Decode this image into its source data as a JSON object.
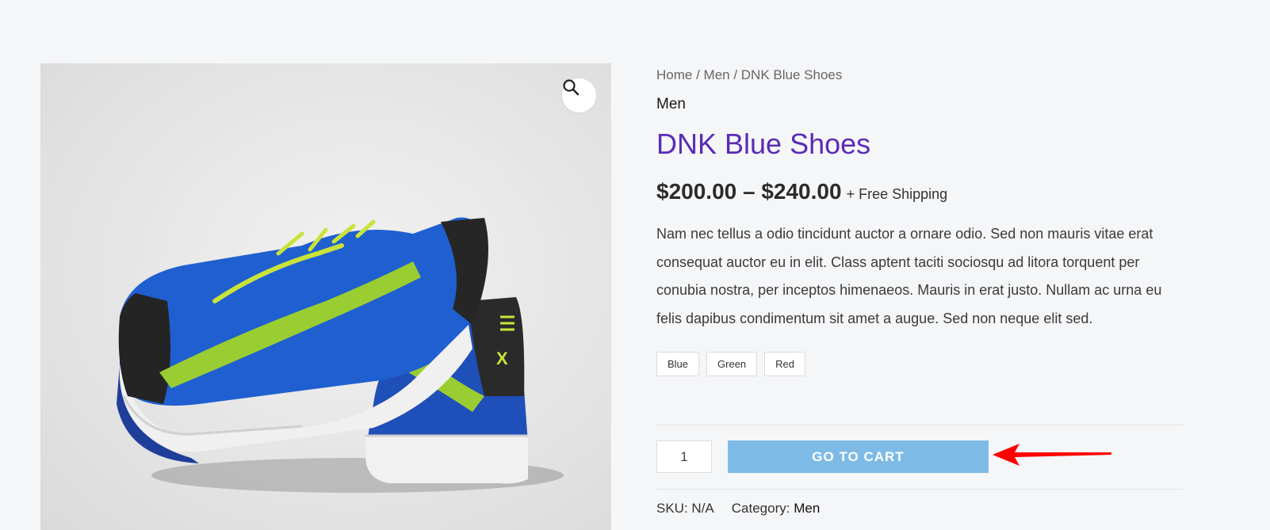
{
  "breadcrumb": {
    "home": "Home",
    "sep1": " / ",
    "men": "Men",
    "sep2": " / ",
    "current": "DNK Blue Shoes"
  },
  "product": {
    "category": "Men",
    "title": "DNK Blue Shoes",
    "price_range": "$200.00 – $240.00",
    "shipping": "+ Free Shipping",
    "description": "Nam nec tellus a odio tincidunt auctor a ornare odio. Sed non mauris vitae erat consequat auctor eu in elit. Class aptent taciti sociosqu ad litora torquent per conubia nostra, per inceptos himenaeos. Mauris in erat justo. Nullam ac urna eu felis dapibus condimentum sit amet a augue. Sed non neque elit sed.",
    "swatches": [
      "Blue",
      "Green",
      "Red"
    ],
    "quantity": "1",
    "cart_button": "GO TO CART",
    "sku_label": "SKU:",
    "sku_value": "N/A",
    "category_label": "Category:",
    "category_link": "Men"
  },
  "icons": {
    "zoom": "magnifier-icon",
    "annotation": "red-arrow-icon"
  },
  "colors": {
    "title": "#5b2bb7",
    "cart_button": "#7dbbe6",
    "annotation_arrow": "#ff0000",
    "background": "#f5f6f8"
  }
}
